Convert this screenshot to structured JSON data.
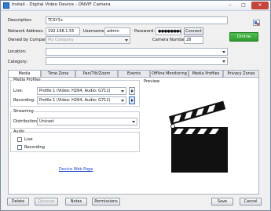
{
  "window": {
    "title": "Install - Digital Video Device - ONVIF Camera",
    "minimize": "–",
    "maximize": "□",
    "close": "✕"
  },
  "form": {
    "description_label": "Description:",
    "description_value": "TCSY3+",
    "network_label": "Network Address:",
    "network_value": "192.168.1.55",
    "username_label": "Username:",
    "username_value": "admin",
    "password_label": "Password:",
    "password_value": "●●●●●●●●●",
    "connect_label": "Connect",
    "owned_label": "Owned by Company:",
    "owned_value": "My Company",
    "camera_number_label": "Camera Number:",
    "camera_number_value": "28",
    "online_label": "Online",
    "location_label": "Location:",
    "location_value": "",
    "category_label": "Category:",
    "category_value": ""
  },
  "tabs": [
    "Media",
    "Time Zone",
    "Pan/Tilt/Zoom",
    "Events",
    "Offline Monitoring",
    "Media Profiles",
    "Privacy Zones"
  ],
  "media_profiles": {
    "title": "Media Profiles",
    "live_label": "Live:",
    "live_value": "Profile 1 (Video: H264, Audio: G711)",
    "recording_label": "Recording:",
    "recording_value": "Profile 1 (Video: H264, Audio: G711)"
  },
  "streaming": {
    "title": "Streaming",
    "distribution_label": "Distribution:",
    "distribution_value": "Unicast"
  },
  "audio": {
    "title": "Audio",
    "live_label": "Live",
    "recording_label": "Recording"
  },
  "device_link": "Device Web Page",
  "preview": {
    "title": "Preview"
  },
  "footer": {
    "delete": "Delete",
    "discover": "Discover",
    "notes": "Notes",
    "permissions": "Permissions",
    "save": "Save",
    "cancel": "Cancel"
  },
  "colors": {
    "online_green": "#34a534",
    "accent_blue": "#3270c8"
  }
}
